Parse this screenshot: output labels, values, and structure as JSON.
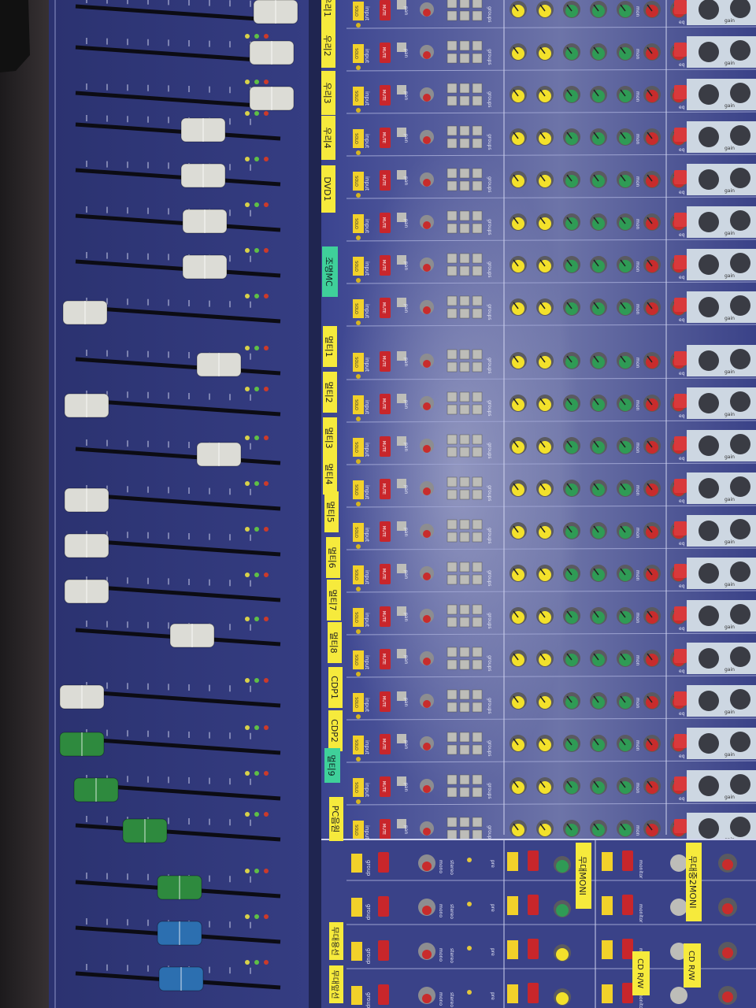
{
  "scene": {
    "colors": {
      "desk": "#2a2628",
      "panel": "#2e3470",
      "panel_dark": "#232a5e",
      "fader_cap": "#dcdcd6",
      "fader_green": "#2e8a3e",
      "fader_blue": "#2c6fb0",
      "tape_yellow": "#f6ea3c",
      "tape_green": "#3fd09a",
      "mute_red": "#c8262b",
      "solo_yellow": "#f2d12a",
      "knob_yellow": "#f3e12b",
      "knob_green": "#2f9b55",
      "knob_red": "#c82c2c",
      "button_grey": "#bdbdb8"
    },
    "fader_caps": [
      "white",
      "white",
      "white",
      "white",
      "white",
      "white",
      "white",
      "white",
      "white",
      "white",
      "white",
      "white",
      "white",
      "white",
      "white",
      "white",
      "green",
      "green",
      "green",
      "green",
      "blue",
      "blue",
      "blue"
    ],
    "channel_strip_labels": {
      "strip_1": "우리1",
      "strip_2": "우리2",
      "strip_3": "우리3",
      "strip_4": "우리4",
      "strip_5": "DVD1",
      "strip_7": "조명MC",
      "strip_9": "멀티1",
      "strip_10": "멀티2",
      "strip_11": "멀티3",
      "strip_12": "멀티4",
      "strip_13": "멀티5",
      "strip_14": "멀티6",
      "strip_15": "멀티7",
      "strip_16": "멀티8",
      "strip_17": "CDP1",
      "strip_18": "CDP2",
      "strip_19": "멀티9",
      "strip_20": "PC음원"
    },
    "monitor_labels": {
      "mon_1": "무대MONI",
      "mon_2": "무대중2MONI",
      "cd_rw_1": "CD R/W",
      "cd_rw_2": "CD R/W"
    },
    "group_labels": {
      "group_3": "무대용선",
      "group_4": "무대앞선"
    },
    "strip_text": {
      "solo": "SOLO",
      "mute": "MUTE",
      "input": "input",
      "pan": "pan",
      "groups": "groups",
      "group": "group",
      "mono": "mono",
      "stereo": "stereo",
      "aux": "aux",
      "mon": "mon",
      "eq": "eq",
      "gain": "gain",
      "pre": "pre",
      "monitor": "monitor"
    }
  }
}
